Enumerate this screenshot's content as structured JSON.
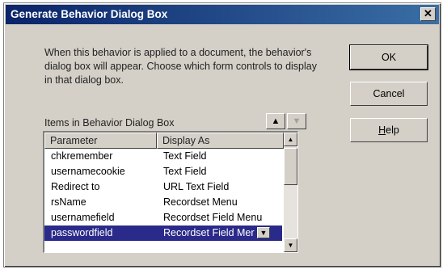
{
  "window": {
    "title": "Generate Behavior Dialog Box",
    "close_glyph": "✕"
  },
  "description": "When this behavior is applied to a document, the behavior's dialog box will appear.  Choose which form controls to display in that dialog box.",
  "buttons": {
    "ok": "OK",
    "cancel": "Cancel",
    "help_prefix": "H",
    "help_rest": "elp"
  },
  "items_label": "Items in Behavior Dialog Box",
  "move_up_icon": "triangle-up-icon",
  "move_down_icon": "triangle-down-icon",
  "list": {
    "columns": [
      "Parameter",
      "Display As"
    ],
    "rows": [
      {
        "parameter": "chkremember",
        "display_as": "Text Field"
      },
      {
        "parameter": "usernamecookie",
        "display_as": "Text Field"
      },
      {
        "parameter": "Redirect to",
        "display_as": "URL Text Field"
      },
      {
        "parameter": "rsName",
        "display_as": "Recordset Menu"
      },
      {
        "parameter": "usernamefield",
        "display_as": "Recordset Field Menu"
      },
      {
        "parameter": "passwordfield",
        "display_as": "Recordset Field Mer",
        "selected": true
      }
    ]
  },
  "colors": {
    "title_bar": "#0a246a",
    "selection": "#2a2a8a",
    "face": "#d4d0c8"
  }
}
